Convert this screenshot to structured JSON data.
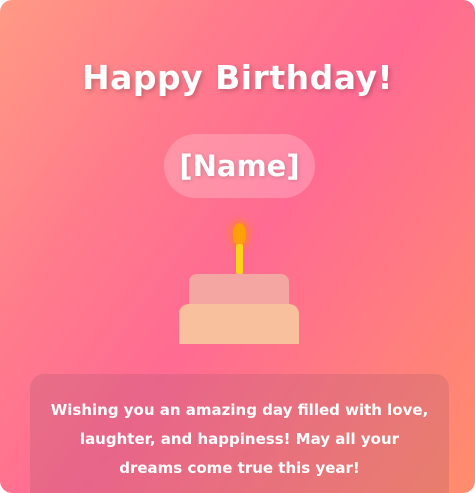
{
  "card": {
    "title": "Happy Birthday!",
    "name": "[Name]",
    "message": "Wishing you an amazing day filled with love, laughter, and happiness! May all your dreams come true this year!"
  },
  "icons": {
    "cake": "birthday-cake-icon",
    "flame": "candle-flame-icon"
  },
  "colors": {
    "gradient_start": "#ff9a84",
    "gradient_mid": "#ff6b92",
    "gradient_end": "#ff8d6b",
    "text": "#ffffff",
    "flame": "#ff9f0a",
    "candle": "#ffd21a",
    "cake_top": "#f4a6a2",
    "cake_bottom": "#f8c09c"
  }
}
